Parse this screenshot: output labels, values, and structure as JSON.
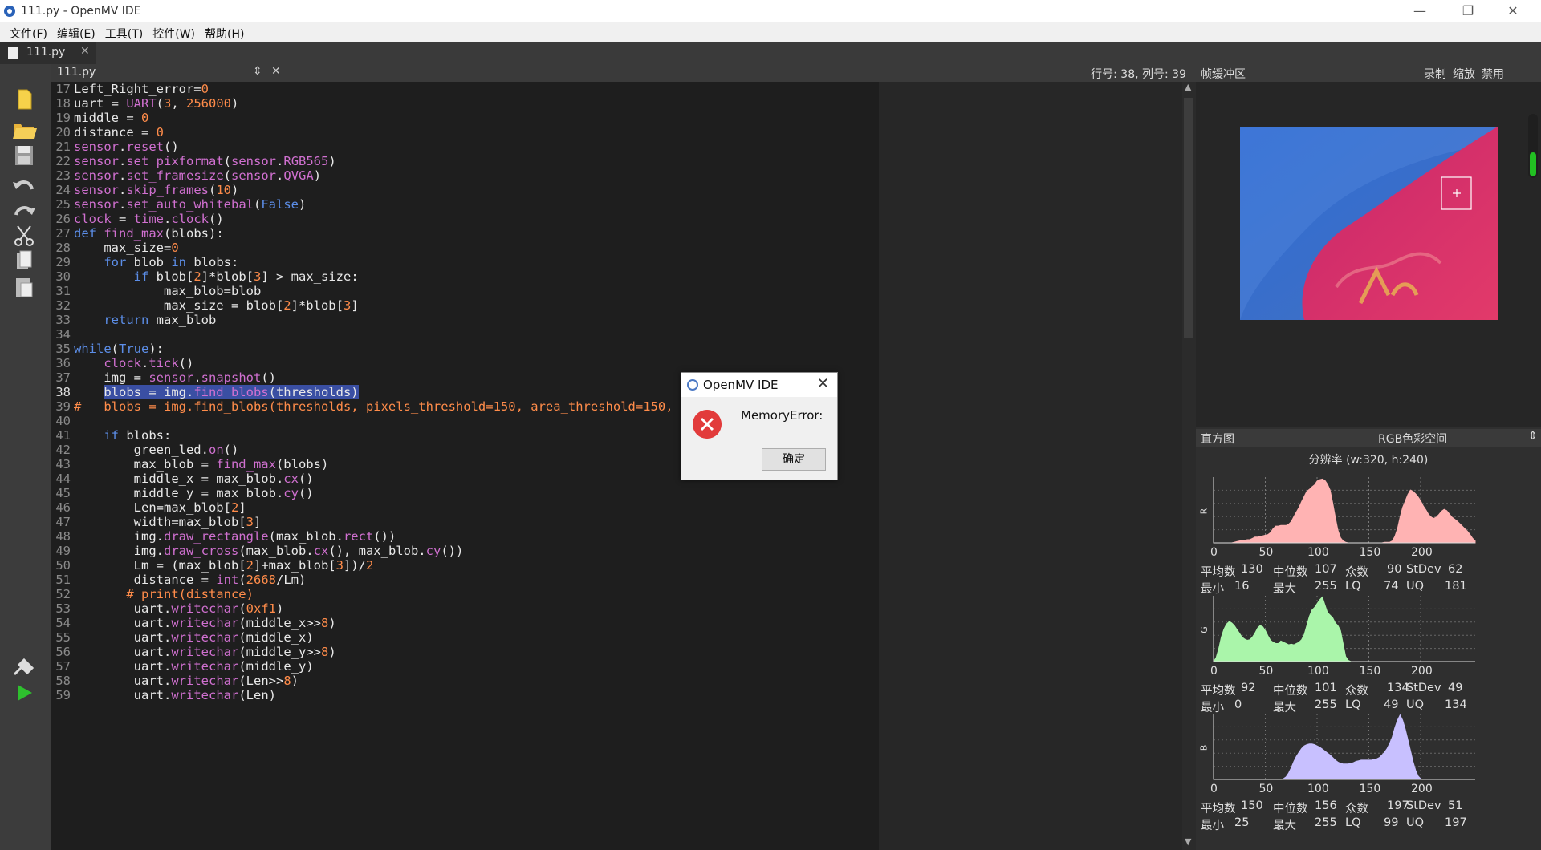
{
  "window": {
    "title": "111.py - OpenMV IDE",
    "min": "—",
    "max": "❐",
    "close": "✕"
  },
  "menu": [
    "文件(F)",
    "编辑(E)",
    "工具(T)",
    "控件(W)",
    "帮助(H)"
  ],
  "tab": {
    "name": "111.py",
    "close": "✕"
  },
  "editor_header": {
    "file": "111.py",
    "sort": "⇕",
    "close": "✕",
    "position": "行号: 38, 列号: 39"
  },
  "code_lines": [
    {
      "n": "17",
      "t": "Left_Right_error=0"
    },
    {
      "n": "18",
      "t": "uart = UART(3, 256000)"
    },
    {
      "n": "19",
      "t": "middle = 0"
    },
    {
      "n": "20",
      "t": "distance = 0"
    },
    {
      "n": "21",
      "t": "sensor.reset()"
    },
    {
      "n": "22",
      "t": "sensor.set_pixformat(sensor.RGB565)"
    },
    {
      "n": "23",
      "t": "sensor.set_framesize(sensor.QVGA)"
    },
    {
      "n": "24",
      "t": "sensor.skip_frames(10)"
    },
    {
      "n": "25",
      "t": "sensor.set_auto_whitebal(False)"
    },
    {
      "n": "26",
      "t": "clock = time.clock()"
    },
    {
      "n": "27",
      "t": "def find_max(blobs):"
    },
    {
      "n": "28",
      "t": "    max_size=0"
    },
    {
      "n": "29",
      "t": "    for blob in blobs:"
    },
    {
      "n": "30",
      "t": "        if blob[2]*blob[3] > max_size:"
    },
    {
      "n": "31",
      "t": "            max_blob=blob"
    },
    {
      "n": "32",
      "t": "            max_size = blob[2]*blob[3]"
    },
    {
      "n": "33",
      "t": "    return max_blob"
    },
    {
      "n": "34",
      "t": ""
    },
    {
      "n": "35",
      "t": "while(True):"
    },
    {
      "n": "36",
      "t": "    clock.tick()"
    },
    {
      "n": "37",
      "t": "    img = sensor.snapshot()"
    },
    {
      "n": "38",
      "t": "    blobs = img.find_blobs(thresholds)"
    },
    {
      "n": "39",
      "t": "#   blobs = img.find_blobs(thresholds, pixels_threshold=150, area_threshold=150, merge=True)"
    },
    {
      "n": "40",
      "t": ""
    },
    {
      "n": "41",
      "t": "    if blobs:"
    },
    {
      "n": "42",
      "t": "        green_led.on()"
    },
    {
      "n": "43",
      "t": "        max_blob = find_max(blobs)"
    },
    {
      "n": "44",
      "t": "        middle_x = max_blob.cx()"
    },
    {
      "n": "45",
      "t": "        middle_y = max_blob.cy()"
    },
    {
      "n": "46",
      "t": "        Len=max_blob[2]"
    },
    {
      "n": "47",
      "t": "        width=max_blob[3]"
    },
    {
      "n": "48",
      "t": "        img.draw_rectangle(max_blob.rect())"
    },
    {
      "n": "49",
      "t": "        img.draw_cross(max_blob.cx(), max_blob.cy())"
    },
    {
      "n": "50",
      "t": "        Lm = (max_blob[2]+max_blob[3])/2"
    },
    {
      "n": "51",
      "t": "        distance = int(2668/Lm)"
    },
    {
      "n": "52",
      "t": "       # print(distance)"
    },
    {
      "n": "53",
      "t": "        uart.writechar(0xf1)"
    },
    {
      "n": "54",
      "t": "        uart.writechar(middle_x>>8)"
    },
    {
      "n": "55",
      "t": "        uart.writechar(middle_x)"
    },
    {
      "n": "56",
      "t": "        uart.writechar(middle_y>>8)"
    },
    {
      "n": "57",
      "t": "        uart.writechar(middle_y)"
    },
    {
      "n": "58",
      "t": "        uart.writechar(Len>>8)"
    },
    {
      "n": "59",
      "t": "        uart.writechar(Len)"
    }
  ],
  "framebuffer": {
    "title": "帧缓冲区",
    "record": "录制",
    "zoom": "缩放",
    "disable": "禁用"
  },
  "histogram": {
    "title": "直方图",
    "colorspace": "RGB色彩空间",
    "resolution": "分辨率 (w:320, h:240)",
    "ticks": [
      "0",
      "50",
      "100",
      "150",
      "200"
    ],
    "channels": [
      {
        "label": "R",
        "color": "#ffb3b3",
        "stats1": [
          "平均数",
          "130",
          "中位数",
          "107",
          "众数",
          "90",
          "StDev",
          "62"
        ],
        "stats2": [
          "最小",
          "16",
          "最大",
          "255",
          "LQ",
          "74",
          "UQ",
          "181"
        ],
        "curve": [
          0,
          0,
          0,
          0,
          0,
          0,
          0,
          0,
          1,
          2,
          3,
          4,
          4,
          5,
          5,
          7,
          9,
          9,
          10,
          11,
          12,
          13,
          16,
          22,
          26,
          26,
          27,
          27,
          27,
          29,
          33,
          41,
          48,
          55,
          64,
          72,
          80,
          83,
          87,
          90,
          96,
          98,
          99,
          97,
          91,
          82,
          62,
          40,
          20,
          8,
          3,
          1,
          0,
          0,
          0,
          0,
          0,
          0,
          0,
          0,
          0,
          0,
          0,
          0,
          0,
          0,
          1,
          1,
          1,
          3,
          10,
          22,
          40,
          55,
          65,
          75,
          82,
          80,
          76,
          71,
          65,
          57,
          51,
          44,
          40,
          38,
          40,
          44,
          49,
          52,
          50,
          45,
          40,
          37,
          34,
          30,
          26,
          22,
          18,
          13,
          7,
          3
        ]
      },
      {
        "label": "G",
        "color": "#aaf5aa",
        "stats1": [
          "平均数",
          "92",
          "中位数",
          "101",
          "众数",
          "134",
          "StDev",
          "49"
        ],
        "stats2": [
          "最小",
          "0",
          "最大",
          "255",
          "LQ",
          "49",
          "UQ",
          "134"
        ],
        "curve": [
          0,
          6,
          20,
          38,
          50,
          58,
          62,
          60,
          56,
          50,
          44,
          38,
          35,
          33,
          34,
          38,
          44,
          52,
          56,
          54,
          48,
          40,
          33,
          30,
          28,
          28,
          32,
          30,
          28,
          26,
          27,
          26,
          28,
          30,
          34,
          42,
          56,
          70,
          80,
          84,
          90,
          96,
          100,
          88,
          76,
          72,
          68,
          60,
          56,
          48,
          28,
          8,
          2,
          0,
          0,
          0,
          0,
          0,
          0,
          0,
          0,
          0,
          0,
          0,
          0,
          0,
          0,
          0,
          0,
          0,
          0,
          0,
          0,
          0,
          0,
          0,
          0,
          0,
          0,
          0,
          0,
          0,
          0,
          0,
          0,
          0,
          0,
          0,
          0,
          0,
          0,
          0,
          0,
          0,
          0,
          0,
          0,
          0,
          0,
          0,
          0,
          0
        ]
      },
      {
        "label": "B",
        "color": "#c8c0ff",
        "stats1": [
          "平均数",
          "150",
          "中位数",
          "156",
          "众数",
          "197",
          "StDev",
          "51"
        ],
        "stats2": [
          "最小",
          "25",
          "最大",
          "255",
          "LQ",
          "99",
          "UQ",
          "197"
        ],
        "curve": [
          0,
          0,
          0,
          0,
          0,
          0,
          0,
          0,
          0,
          0,
          0,
          0,
          0,
          0,
          0,
          0,
          0,
          0,
          0,
          0,
          0,
          0,
          0,
          0,
          0,
          0,
          0,
          1,
          4,
          10,
          18,
          28,
          36,
          42,
          48,
          52,
          54,
          55,
          55,
          54,
          52,
          50,
          47,
          44,
          41,
          38,
          34,
          30,
          27,
          25,
          24,
          24,
          24,
          25,
          26,
          28,
          29,
          30,
          30,
          30,
          30,
          30,
          31,
          32,
          34,
          38,
          42,
          48,
          56,
          66,
          80,
          92,
          100,
          92,
          78,
          62,
          45,
          28,
          14,
          5,
          1,
          0,
          0,
          0,
          0,
          0,
          0,
          0,
          0,
          0,
          0,
          0,
          0,
          0,
          0,
          0,
          0,
          0,
          0,
          0,
          0,
          0
        ]
      }
    ]
  },
  "dialog": {
    "title": "OpenMV IDE",
    "close": "✕",
    "message": "MemoryError:",
    "ok": "确定"
  }
}
